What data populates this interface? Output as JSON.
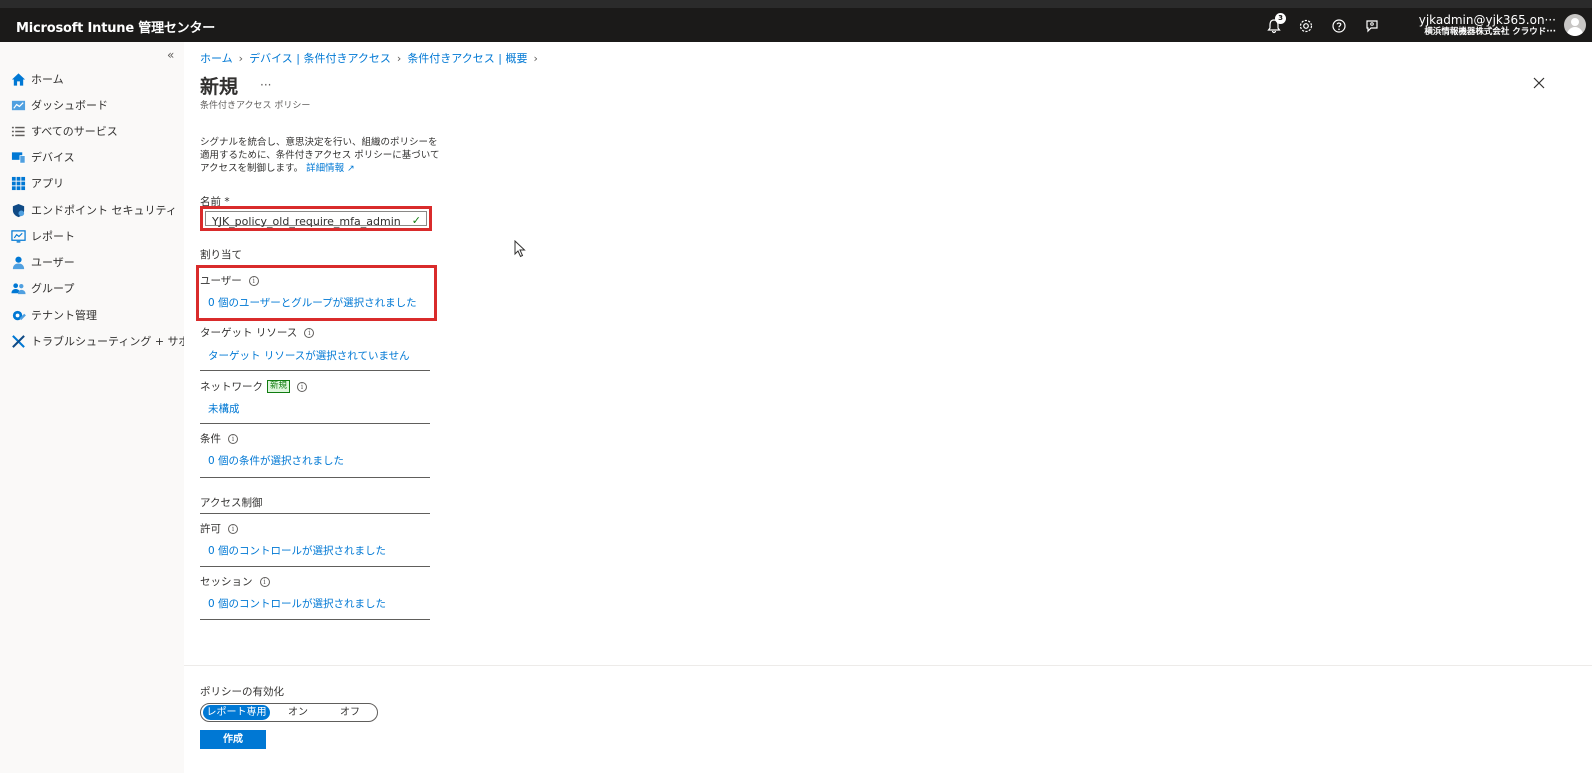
{
  "topbar": {
    "brand": "Microsoft Intune 管理センター",
    "notification_count": "3",
    "account_email": "yjkadmin@yjk365.on···",
    "account_org": "横浜情報機器株式会社 クラウド···",
    "icons": [
      "bell-icon",
      "gear-icon",
      "help-icon",
      "feedback-icon"
    ]
  },
  "sidebar": {
    "collapse": "«",
    "items": [
      {
        "label": "ホーム",
        "icon": "home-icon"
      },
      {
        "label": "ダッシュボード",
        "icon": "dashboard-icon"
      },
      {
        "label": "すべてのサービス",
        "icon": "list-icon"
      },
      {
        "label": "デバイス",
        "icon": "device-icon"
      },
      {
        "label": "アプリ",
        "icon": "apps-grid-icon"
      },
      {
        "label": "エンドポイント セキュリティ",
        "icon": "shield-icon"
      },
      {
        "label": "レポート",
        "icon": "report-icon"
      },
      {
        "label": "ユーザー",
        "icon": "user-icon"
      },
      {
        "label": "グループ",
        "icon": "group-icon"
      },
      {
        "label": "テナント管理",
        "icon": "tenant-admin-icon"
      },
      {
        "label": "トラブルシューティング + サポート",
        "icon": "troubleshoot-icon"
      }
    ]
  },
  "breadcrumb": [
    "ホーム",
    "デバイス | 条件付きアクセス",
    "条件付きアクセス | 概要"
  ],
  "page": {
    "title": "新規",
    "more": "···",
    "subtitle": "条件付きアクセス ポリシー",
    "desc_text": "シグナルを統合し、意思決定を行い、組織のポリシーを適用するために、条件付きアクセス ポリシーに基づいてアクセスを制御します。",
    "desc_link": "詳細情報",
    "name_label": "名前 *",
    "name_value": "YJK_policy_old_require_mfa_admin",
    "assignments_label": "割り当て",
    "users_label": "ユーザー",
    "users_value": "0 個のユーザーとグループが選択されました",
    "target_label": "ターゲット リソース",
    "target_value": "ターゲット リソースが選択されていません",
    "network_label": "ネットワーク",
    "network_badge": "新規",
    "network_value": "未構成",
    "conditions_label": "条件",
    "conditions_value": "0 個の条件が選択されました",
    "access_controls_label": "アクセス制御",
    "grant_label": "許可",
    "grant_value": "0 個のコントロールが選択されました",
    "session_label": "セッション",
    "session_value": "0 個のコントロールが選択されました",
    "enable_label": "ポリシーの有効化",
    "enable_options": [
      "レポート専用",
      "オン",
      "オフ"
    ],
    "enable_selected": "レポート専用",
    "create_button": "作成"
  },
  "colors": {
    "accent": "#0078d4",
    "highlight_border": "#d92b2b",
    "topbar": "#1b1a19"
  }
}
